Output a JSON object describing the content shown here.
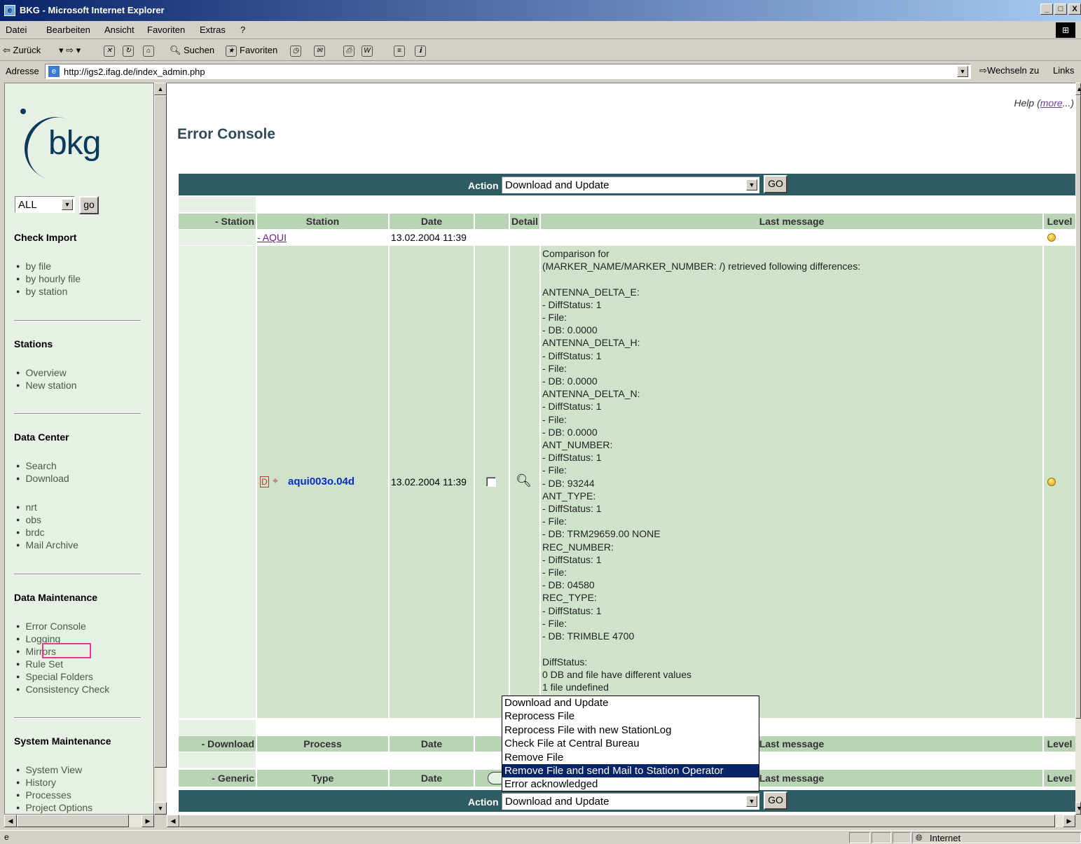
{
  "window": {
    "title": "BKG - Microsoft Internet Explorer",
    "icon": "ie-icon",
    "controls": [
      "_",
      "□",
      "X"
    ]
  },
  "menu": [
    "Datei",
    "Bearbeiten",
    "Ansicht",
    "Favoriten",
    "Extras",
    "?"
  ],
  "toolbar": {
    "back": "⇦ Zurück",
    "search": "Suchen",
    "favorites": "Favoriten"
  },
  "address": {
    "label": "Adresse",
    "url": "http://igs2.ifag.de/index_admin.php",
    "go": "Wechseln zu",
    "links": "Links"
  },
  "sidebar": {
    "logo_text": "bkg",
    "filter_value": "ALL",
    "go_label": "go",
    "sections": [
      {
        "title": "Check Import",
        "items": [
          "by file",
          "by hourly file",
          "by station"
        ]
      },
      {
        "title": "Stations",
        "items": [
          "Overview",
          "New station"
        ]
      },
      {
        "title": "Data Center",
        "items": [
          "Search",
          "Download"
        ],
        "items2": [
          "nrt",
          "obs",
          "brdc",
          "Mail Archive"
        ]
      },
      {
        "title": "Data Maintenance",
        "items": [
          "Error Console",
          "Logging",
          "Mirrors",
          "Rule Set",
          "Special Folders",
          "Consistency Check"
        ]
      },
      {
        "title": "System Maintenance",
        "items": [
          "System View",
          "History",
          "Processes",
          "Project Options"
        ]
      }
    ]
  },
  "main": {
    "help": "Help (",
    "help_link": "more",
    "help_tail": "...)",
    "title": "Error Console",
    "action_label": "Action",
    "action_value": "Download and Update",
    "go_label": "GO",
    "station_table": {
      "headers": [
        "- Station",
        "Station",
        "Date",
        "Detail",
        "Last message",
        "Level"
      ],
      "group": {
        "station": "- AQUI",
        "date": "13.02.2004 11:39"
      },
      "row": {
        "file": "aqui003o.04d",
        "date": "13.02.2004 11:39",
        "message": "Comparison for\n(MARKER_NAME/MARKER_NUMBER: /) retrieved following differences:\n\nANTENNA_DELTA_E:\n- DiffStatus: 1\n- File:\n- DB: 0.0000\nANTENNA_DELTA_H:\n- DiffStatus: 1\n- File:\n- DB: 0.0000\nANTENNA_DELTA_N:\n- DiffStatus: 1\n- File:\n- DB: 0.0000\nANT_NUMBER:\n- DiffStatus: 1\n- File:\n- DB: 93244\nANT_TYPE:\n- DiffStatus: 1\n- File:\n- DB: TRM29659.00 NONE\nREC_NUMBER:\n- DiffStatus: 1\n- File:\n- DB: 04580\nREC_TYPE:\n- DiffStatus: 1\n- File:\n- DB: TRIMBLE 4700\n\nDiffStatus:\n0 DB and file have different values\n1 file undefined"
      }
    },
    "download_table": {
      "headers": [
        "- Download",
        "Process",
        "Date",
        "Last message",
        "Level"
      ]
    },
    "generic_table": {
      "headers": [
        "- Generic",
        "Type",
        "Date",
        "Last message",
        "Level"
      ]
    },
    "dropdown_options": [
      "Download and Update",
      "Reprocess File",
      "Reprocess File with new StationLog",
      "Check File at Central Bureau",
      "Remove File",
      "Remove File and send Mail to Station Operator",
      "Error acknowledged"
    ],
    "dropdown_selected_index": 5
  },
  "status": {
    "zone": "Internet"
  },
  "colors": {
    "header_band": "#2f5c64",
    "table_header": "#b9d3b5",
    "row_bg": "#cfe3cb",
    "sidebar_bg": "#e6f0e4",
    "highlight": "#e8398a"
  }
}
